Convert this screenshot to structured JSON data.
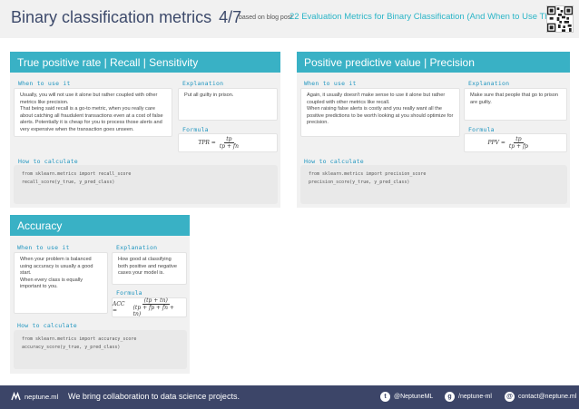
{
  "header": {
    "title": "Binary classification metrics",
    "page": "4/7",
    "based_on": "based on blog post",
    "blog_link": "22 Evaluation Metrics for Binary Classification (And When to Use Them)"
  },
  "labels": {
    "when": "When to use it",
    "explanation": "Explanation",
    "formula": "Formula",
    "how": "How to calculate"
  },
  "cards": {
    "tpr": {
      "title": "True positive rate | Recall | Sensitivity",
      "when": "Usually, you will not use it alone but rather coupled with other metrics like precision.\nThat being said recall is a go-to metric, when you really care about catching all fraudulent transactions even at a cost of false alerts. Potentially it is cheap for you to process those alerts and very expensive when the transaction goes unseen.",
      "explanation": "Put all guilty in prison.",
      "formula": {
        "lhs": "TPR =",
        "num": "tp",
        "den": "tp + fn"
      },
      "code": "from sklearn.metrics import recall_score\nrecall_score(y_true, y_pred_class)"
    },
    "ppv": {
      "title": "Positive predictive value | Precision",
      "when": "Again, it usually doesn't make sense to use it alone but rather coupled with other metrics like recall.\nWhen raising false alerts is costly and you really want all the positive predictions to be worth looking at you should optimize for precision.",
      "explanation": "Make sure that people that go to prison are guilty.",
      "formula": {
        "lhs": "PPV =",
        "num": "tp",
        "den": "tp + fp"
      },
      "code": "from sklearn.metrics import precision_score\nprecision_score(y_true, y_pred_class)"
    },
    "acc": {
      "title": "Accuracy",
      "when": "When your problem is balanced using accuracy is usually a good start.\nWhen every class is equally important to you.",
      "explanation": "How good at classifying both positive and negative cases your model is.",
      "formula": {
        "lhs": "ACC =",
        "num": "(tp + tn)",
        "den": "(tp + fp + fn + tn)"
      },
      "code": "from sklearn.metrics import accuracy_score\naccuracy_score(y_true, y_pred_class)"
    }
  },
  "footer": {
    "logo": "neptune.ml",
    "tagline": "We bring collaboration to data science projects.",
    "twitter": "@NeptuneML",
    "github": "/neptune-ml",
    "email": "contact@neptune.ml"
  },
  "colors": {
    "accent": "#39b1c5",
    "footer": "#3c4568",
    "title": "#3d4a6b"
  }
}
